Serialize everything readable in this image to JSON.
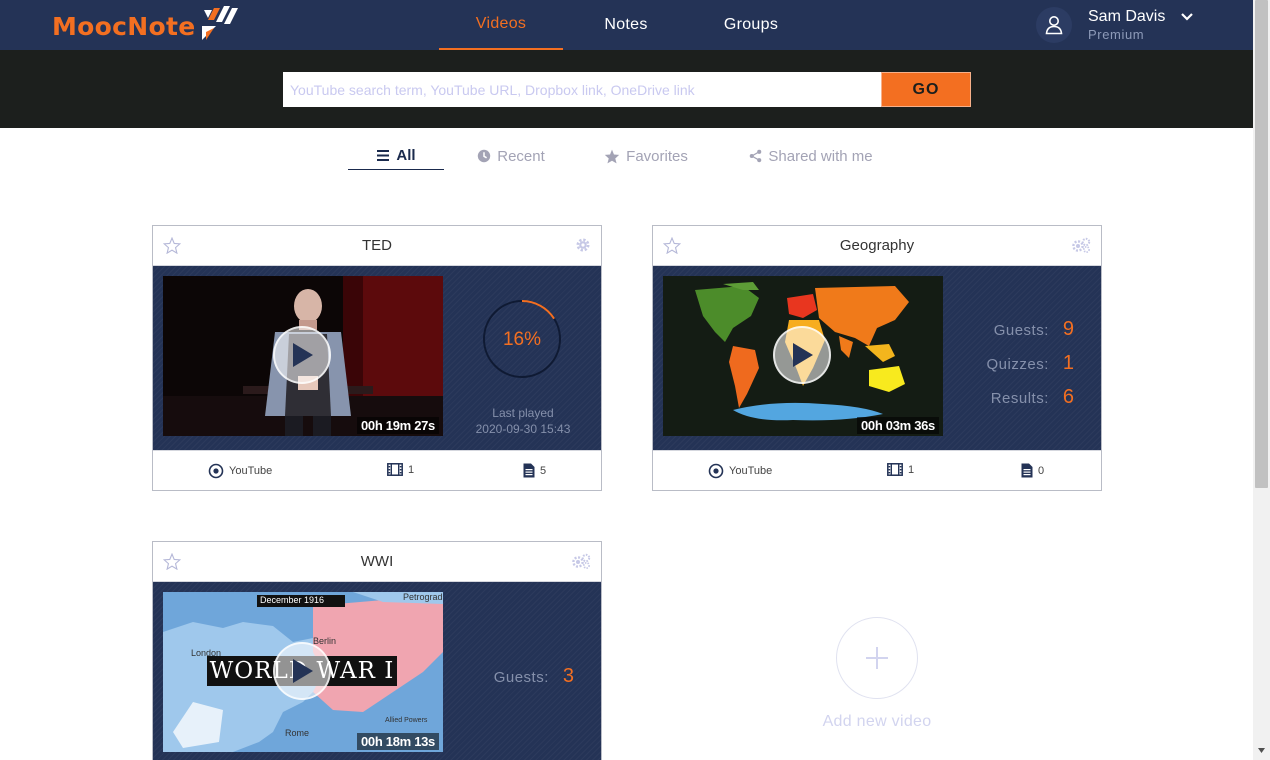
{
  "app": {
    "logo": "MoocNote",
    "brand_color": "#f36f21",
    "header_color": "#243356"
  },
  "nav": {
    "tabs": [
      {
        "label": "Videos",
        "active": true
      },
      {
        "label": "Notes",
        "active": false
      },
      {
        "label": "Groups",
        "active": false
      }
    ]
  },
  "user": {
    "name": "Sam Davis",
    "plan": "Premium",
    "icon": "user-icon"
  },
  "search": {
    "placeholder": "YouTube search term, YouTube URL, Dropbox link, OneDrive link",
    "value": "",
    "go_label": "GO"
  },
  "filters": [
    {
      "label": "All",
      "icon": "list-icon",
      "active": true
    },
    {
      "label": "Recent",
      "icon": "clock-icon",
      "active": false
    },
    {
      "label": "Favorites",
      "icon": "star-icon",
      "active": false
    },
    {
      "label": "Shared with me",
      "icon": "share-icon",
      "active": false
    }
  ],
  "cards": [
    {
      "title": "TED",
      "duration": "00h 19m 27s",
      "progress": "16%",
      "progress_fraction": 0.16,
      "last_played_label": "Last played",
      "last_played": "2020-09-30 15:43",
      "source": "YouTube",
      "clips": "1",
      "notes": "5"
    },
    {
      "title": "Geography",
      "duration": "00h 03m 36s",
      "stats": [
        {
          "label": "Guests:",
          "value": "9"
        },
        {
          "label": "Quizzes:",
          "value": "1"
        },
        {
          "label": "Results:",
          "value": "6"
        }
      ],
      "source": "YouTube",
      "clips": "1",
      "notes": "0"
    },
    {
      "title": "WWI",
      "duration": "00h 18m 13s",
      "thumb_caption": "WORLD WAR I",
      "thumb_map_date": "December 1916",
      "thumb_map_labels": [
        "London",
        "Rome",
        "Berlin",
        "Petrograd",
        "Allied Powers"
      ],
      "stats": [
        {
          "label": "Guests:",
          "value": "3"
        }
      ]
    }
  ],
  "add_video": {
    "label": "Add new video"
  }
}
